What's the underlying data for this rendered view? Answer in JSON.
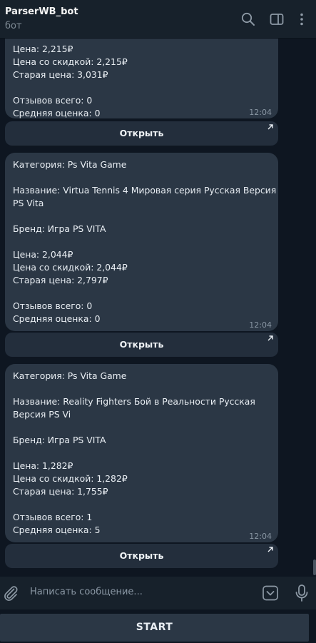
{
  "header": {
    "title": "ParserWB_bot",
    "subtitle": "бот",
    "icons": [
      "search-icon",
      "sidebar-toggle-icon",
      "more-vertical-icon"
    ]
  },
  "messages": [
    {
      "lines": [
        "Цена: 2,215₽",
        "Цена со скидкой: 2,215₽",
        "Старая цена: 3,031₽",
        "",
        "Отзывов всего: 0",
        "Средняя оценка: 0"
      ],
      "time": "12:04",
      "button": "Открыть"
    },
    {
      "lines": [
        "Категория: Ps Vita Game",
        "",
        "Название: Virtua Tennis 4 Мировая серия Русская Версия",
        "PS Vita",
        "",
        "Бренд: Игра PS VITA",
        "",
        "Цена: 2,044₽",
        "Цена со скидкой: 2,044₽",
        "Старая цена: 2,797₽",
        "",
        "Отзывов всего: 0",
        "Средняя оценка: 0"
      ],
      "time": "12:04",
      "button": "Открыть"
    },
    {
      "lines": [
        "Категория: Ps Vita Game",
        "",
        "Название: Reality Fighters Бой в Реальности Русская",
        "Версия PS Vi",
        "",
        "Бренд: Игра PS VITA",
        "",
        "Цена: 1,282₽",
        "Цена со скидкой: 1,282₽",
        "Старая цена: 1,755₽",
        "",
        "Отзывов всего: 1",
        "Средняя оценка: 5"
      ],
      "time": "12:04",
      "button": "Открыть"
    }
  ],
  "composer": {
    "placeholder": "Написать сообщение...",
    "icons": [
      "attach-icon",
      "bot-keyboard-icon",
      "microphone-icon"
    ]
  },
  "start_button": "START",
  "colors": {
    "background": "#0e1621",
    "header": "#17212b",
    "bubble": "#2b3745",
    "inline_button": "#232e3c",
    "muted_text": "#8a97a4"
  }
}
